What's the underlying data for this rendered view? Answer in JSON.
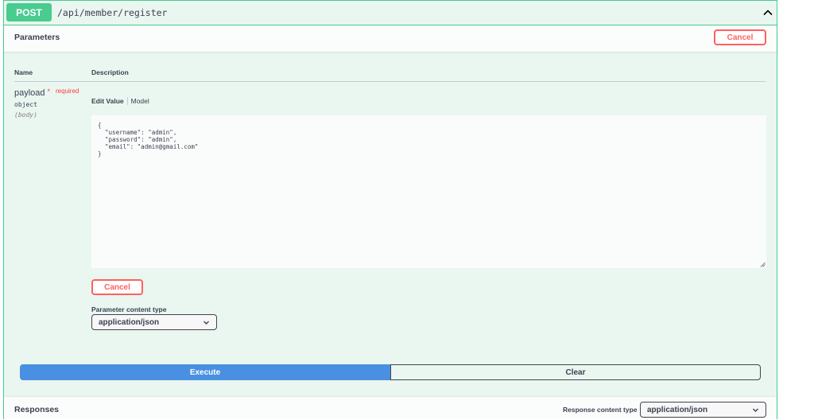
{
  "operation": {
    "method": "POST",
    "path": "/api/member/register",
    "collapse_icon": "chevron-up-icon"
  },
  "parameters": {
    "section_title": "Parameters",
    "cancel_label": "Cancel",
    "columns": {
      "name": "Name",
      "description": "Description"
    },
    "items": [
      {
        "name": "payload",
        "required_marker": "*",
        "required_label": "required",
        "type": "object",
        "in": "(body)",
        "tabs": {
          "edit_value": "Edit Value",
          "model": "Model"
        },
        "value": "{\n  \"username\": \"admin\",\n  \"password\": \"admin\",\n  \"email\": \"admin@gmail.com\"\n}"
      }
    ],
    "inline_cancel_label": "Cancel",
    "content_type_label": "Parameter content type",
    "content_type_value": "application/json"
  },
  "actions": {
    "execute_label": "Execute",
    "clear_label": "Clear"
  },
  "responses": {
    "section_title": "Responses",
    "content_type_label": "Response content type",
    "content_type_value": "application/json"
  },
  "colors": {
    "post_green": "#49cc90",
    "block_bg": "#eaf6f0",
    "cancel_red": "#ff6060",
    "execute_blue": "#4990e2"
  }
}
